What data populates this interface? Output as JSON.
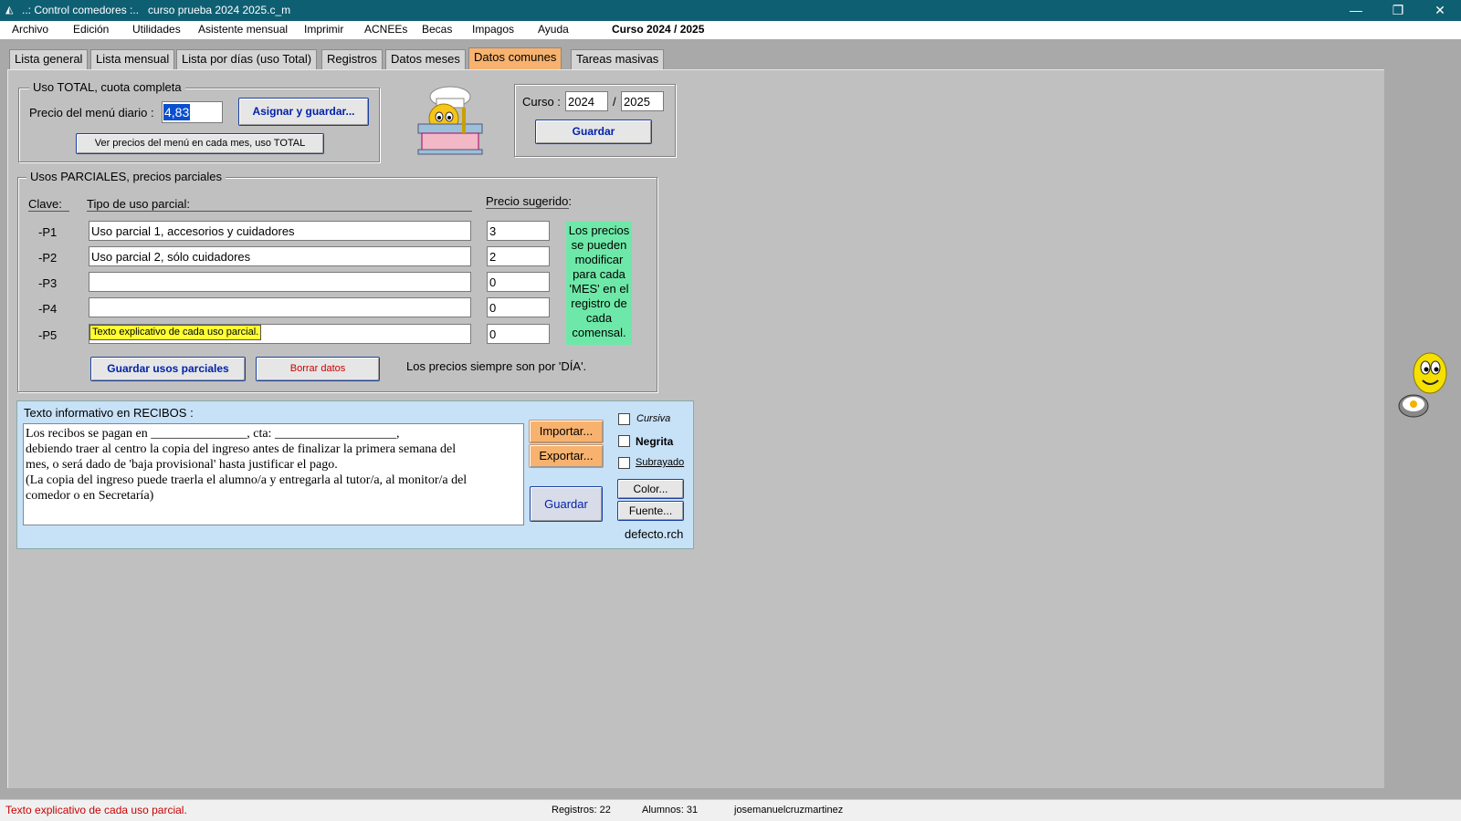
{
  "window": {
    "title": "..: Control comedores :..   curso prueba 2024 2025.c_m",
    "minimize": "—",
    "restore": "❐",
    "close": "✕"
  },
  "menu": {
    "items": [
      "Archivo",
      "Edición",
      "Utilidades",
      "Asistente mensual",
      "Imprimir",
      "ACNEEs",
      "Becas",
      "Impagos",
      "Ayuda"
    ],
    "course": "Curso 2024 / 2025"
  },
  "tabs": [
    "Lista general",
    "Lista mensual",
    "Lista por días (uso Total)",
    "Registros",
    "Datos meses",
    "Datos comunes",
    "Tareas masivas"
  ],
  "active_tab": "Datos comunes",
  "total": {
    "legend": "Uso TOTAL, cuota completa",
    "price_label": "Precio del menú diario :",
    "price_value": "4,83",
    "assign_button": "Asignar y guardar...",
    "view_prices_button": "Ver precios del menú en cada mes, uso TOTAL"
  },
  "curso": {
    "label": "Curso :",
    "year_from": "2024",
    "separator": "/",
    "year_to": "2025",
    "save_button": "Guardar"
  },
  "parciales": {
    "legend": "Usos PARCIALES, precios parciales",
    "col_clave": "Clave:",
    "col_tipo": "Tipo de uso parcial:",
    "col_precio": "Precio sugerido:",
    "rows": [
      {
        "clave": "-P1",
        "tipo": "Uso parcial 1, accesorios y cuidadores",
        "precio": "3"
      },
      {
        "clave": "-P2",
        "tipo": "Uso parcial 2, sólo cuidadores",
        "precio": "2"
      },
      {
        "clave": "-P3",
        "tipo": "",
        "precio": "0"
      },
      {
        "clave": "-P4",
        "tipo": "",
        "precio": "0"
      },
      {
        "clave": "-P5",
        "tipo": "",
        "precio": "0"
      }
    ],
    "tooltip": "Texto explicativo de cada uso parcial.",
    "note": "Los precios se pueden modificar para cada 'MES' en el registro de cada comensal.",
    "save_button": "Guardar usos parciales",
    "delete_button": "Borrar  datos",
    "per_day_note": "Los precios siempre son por 'DÍA'."
  },
  "recibos": {
    "label": "Texto informativo en  RECIBOS :",
    "text": "Los recibos se pagan en _______________, cta: ___________________,\ndebiendo traer al centro la copia del ingreso antes de finalizar la primera semana del\nmes, o será dado de 'baja provisional' hasta justificar el pago.\n(La copia del ingreso puede traerla el alumno/a y entregarla al tutor/a, al monitor/a del\ncomedor o en Secretaría)",
    "import_button": "Importar...",
    "export_button": "Exportar...",
    "save_button": "Guardar",
    "cursiva": "Cursiva",
    "negrita": "Negrita",
    "subrayado": "Subrayado",
    "color_button": "Color...",
    "fuente_button": "Fuente...",
    "file": "defecto.rch"
  },
  "status": {
    "message": "Texto explicativo de cada uso parcial.",
    "registros": "Registros: 22",
    "alumnos": "Alumnos: 31",
    "user": "josemanuelcruzmartinez"
  },
  "colors": {
    "titlebar": "#0f5f73",
    "active_tab": "#f7b26f",
    "note_bg": "#6ee8a8",
    "tooltip_bg": "#ffff33",
    "recibos_bg": "#c7e1f7",
    "status_message": "#cc0000"
  }
}
